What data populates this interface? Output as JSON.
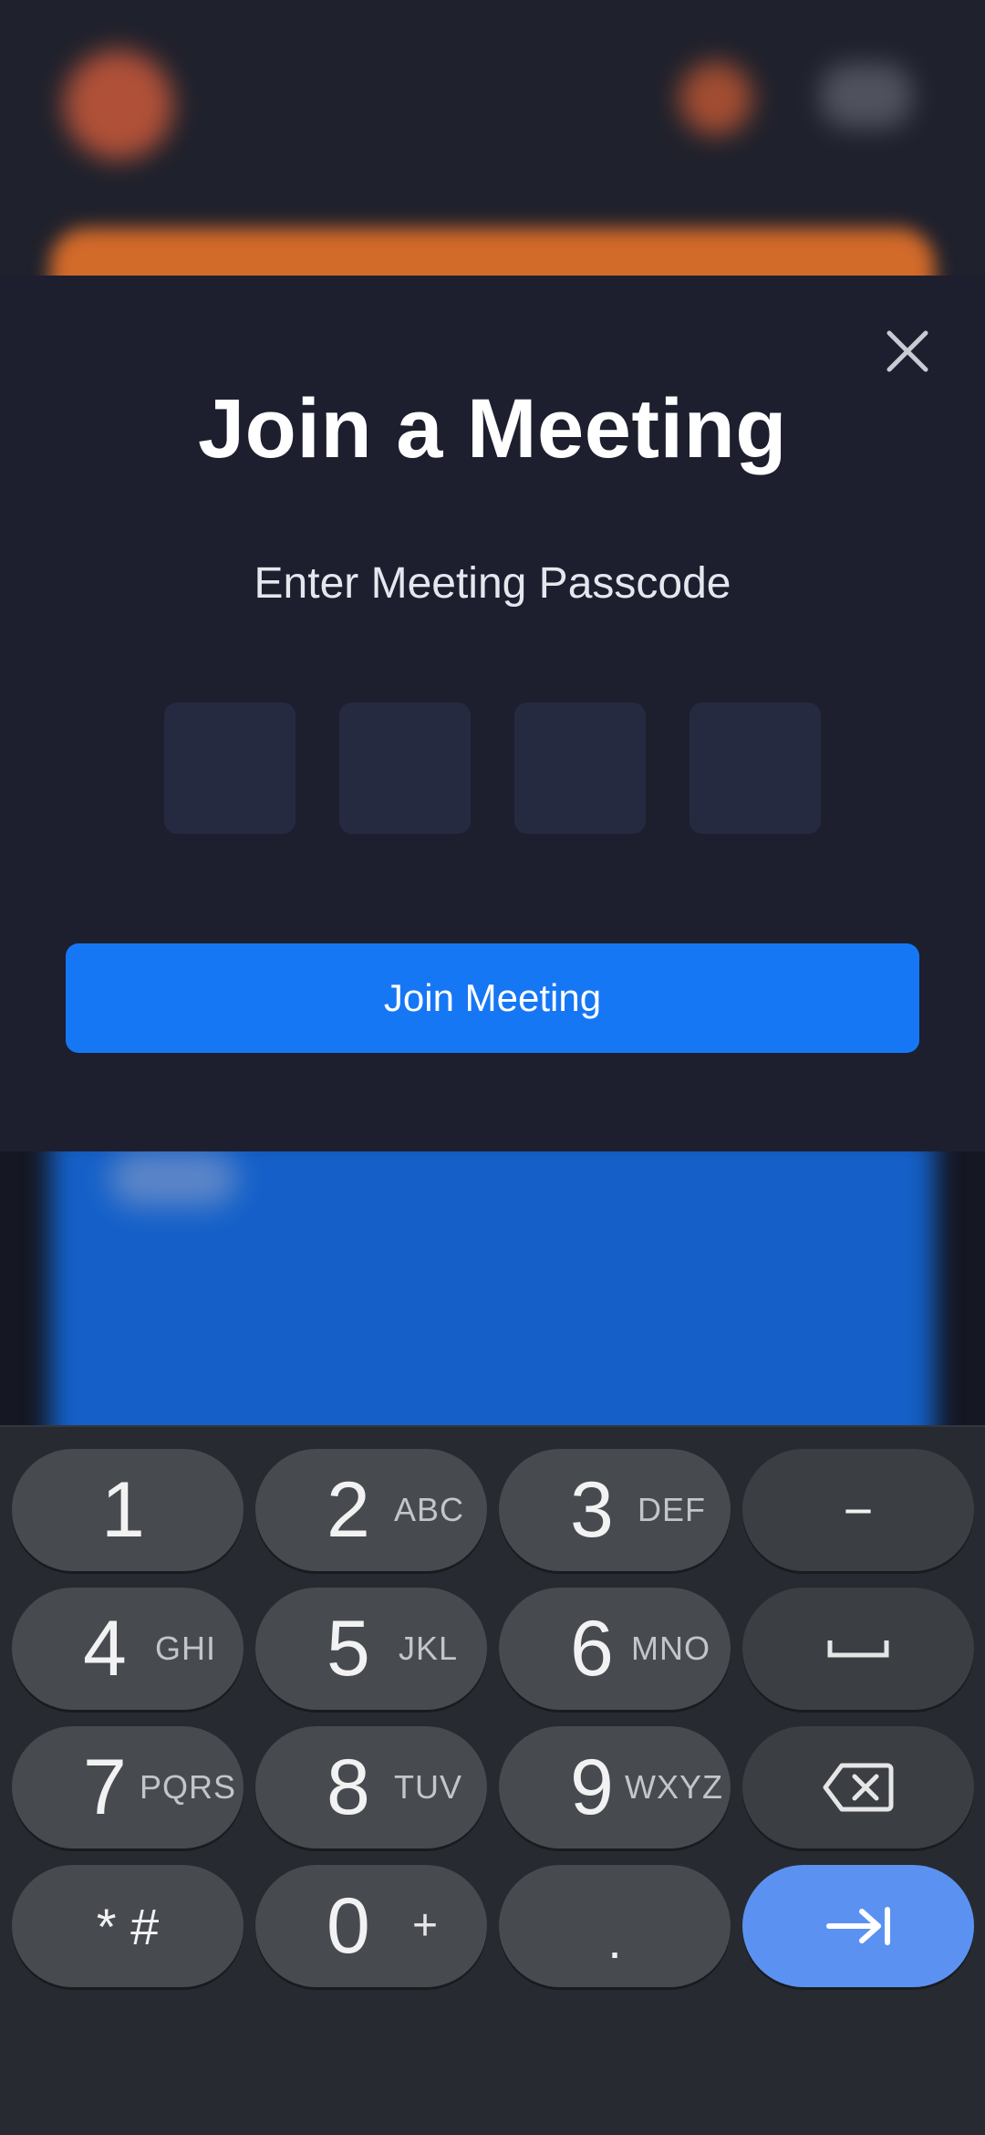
{
  "modal": {
    "title": "Join a Meeting",
    "subtitle": "Enter Meeting Passcode",
    "passcode_digits": [
      "",
      "",
      "",
      ""
    ],
    "join_button_label": "Join Meeting",
    "close_icon": "close-icon"
  },
  "keyboard": {
    "keys": [
      {
        "num": "1",
        "letters": ""
      },
      {
        "num": "2",
        "letters": "ABC"
      },
      {
        "num": "3",
        "letters": "DEF"
      },
      {
        "label": "−"
      },
      {
        "num": "4",
        "letters": "GHI"
      },
      {
        "num": "5",
        "letters": "JKL"
      },
      {
        "num": "6",
        "letters": "MNO"
      },
      {
        "icon": "space-icon"
      },
      {
        "num": "7",
        "letters": "PQRS"
      },
      {
        "num": "8",
        "letters": "TUV"
      },
      {
        "num": "9",
        "letters": "WXYZ"
      },
      {
        "icon": "backspace-icon"
      },
      {
        "label": "* #"
      },
      {
        "num": "0",
        "letters": "+"
      },
      {
        "label": "."
      },
      {
        "icon": "next-tab-icon"
      }
    ]
  },
  "colors": {
    "accent": "#1677f5",
    "enter_key": "#5b92f2",
    "modal_bg": "#1d1f2f",
    "keyboard_bg": "#272b31"
  }
}
